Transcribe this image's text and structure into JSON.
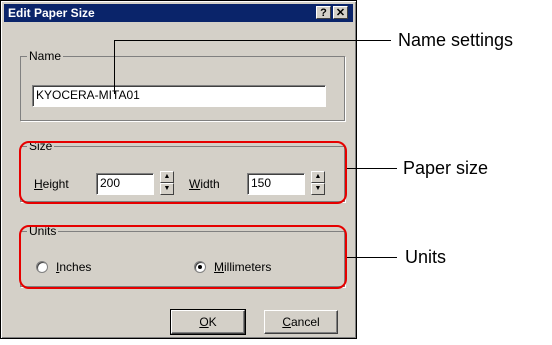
{
  "dialog": {
    "title": "Edit Paper Size",
    "help_button": "?",
    "close_button": "✕"
  },
  "name_group": {
    "legend": "Name",
    "value": "KYOCERA-MITA01"
  },
  "size_group": {
    "legend": "Size",
    "height_label_key": "H",
    "height_label_rest": "eight",
    "height_value": "200",
    "width_label_key": "W",
    "width_label_rest": "idth",
    "width_value": "150"
  },
  "units_group": {
    "legend": "Units",
    "inches_key": "I",
    "inches_rest": "nches",
    "millimeters_key": "M",
    "millimeters_rest": "illimeters",
    "selected": "Millimeters"
  },
  "buttons": {
    "ok_key": "O",
    "ok_rest": "K",
    "cancel_key": "C",
    "cancel_rest": "ancel"
  },
  "annotations": {
    "name_settings": "Name settings",
    "paper_size": "Paper size",
    "units": "Units"
  },
  "colors": {
    "highlight": "#e60000",
    "titlebar": "#0a246a",
    "dialog_face": "#d4d0c8"
  }
}
